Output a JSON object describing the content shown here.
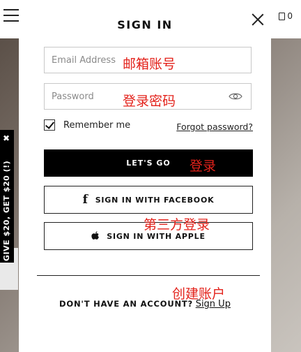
{
  "header": {
    "cart_count": "0"
  },
  "promo": {
    "close_glyph": "✖",
    "text": "GIVE $20, GET $20 (!)"
  },
  "modal": {
    "title": "SIGN IN",
    "email_placeholder": "Email Address",
    "password_placeholder": "Password",
    "remember_label": "Remember me",
    "forgot_label": "Forgot password?",
    "primary_button": "LET'S GO",
    "facebook_button": "SIGN IN WITH FACEBOOK",
    "apple_button": "SIGN IN WITH APPLE",
    "no_account_text": "DON'T HAVE AN ACCOUNT?",
    "signup_link": "Sign Up"
  },
  "annotations": {
    "email": "邮箱账号",
    "password": "登录密码",
    "login": "登录",
    "third_party": "第三方登录",
    "create_account": "创建账户"
  },
  "icons": [
    "menu-icon",
    "bag-icon",
    "close-icon",
    "eye-icon",
    "checkbox-checked-icon",
    "facebook-icon",
    "apple-icon"
  ],
  "colors": {
    "annotation": "#e3221b",
    "primary_button_bg": "#000000",
    "modal_bg": "#ffffff"
  }
}
